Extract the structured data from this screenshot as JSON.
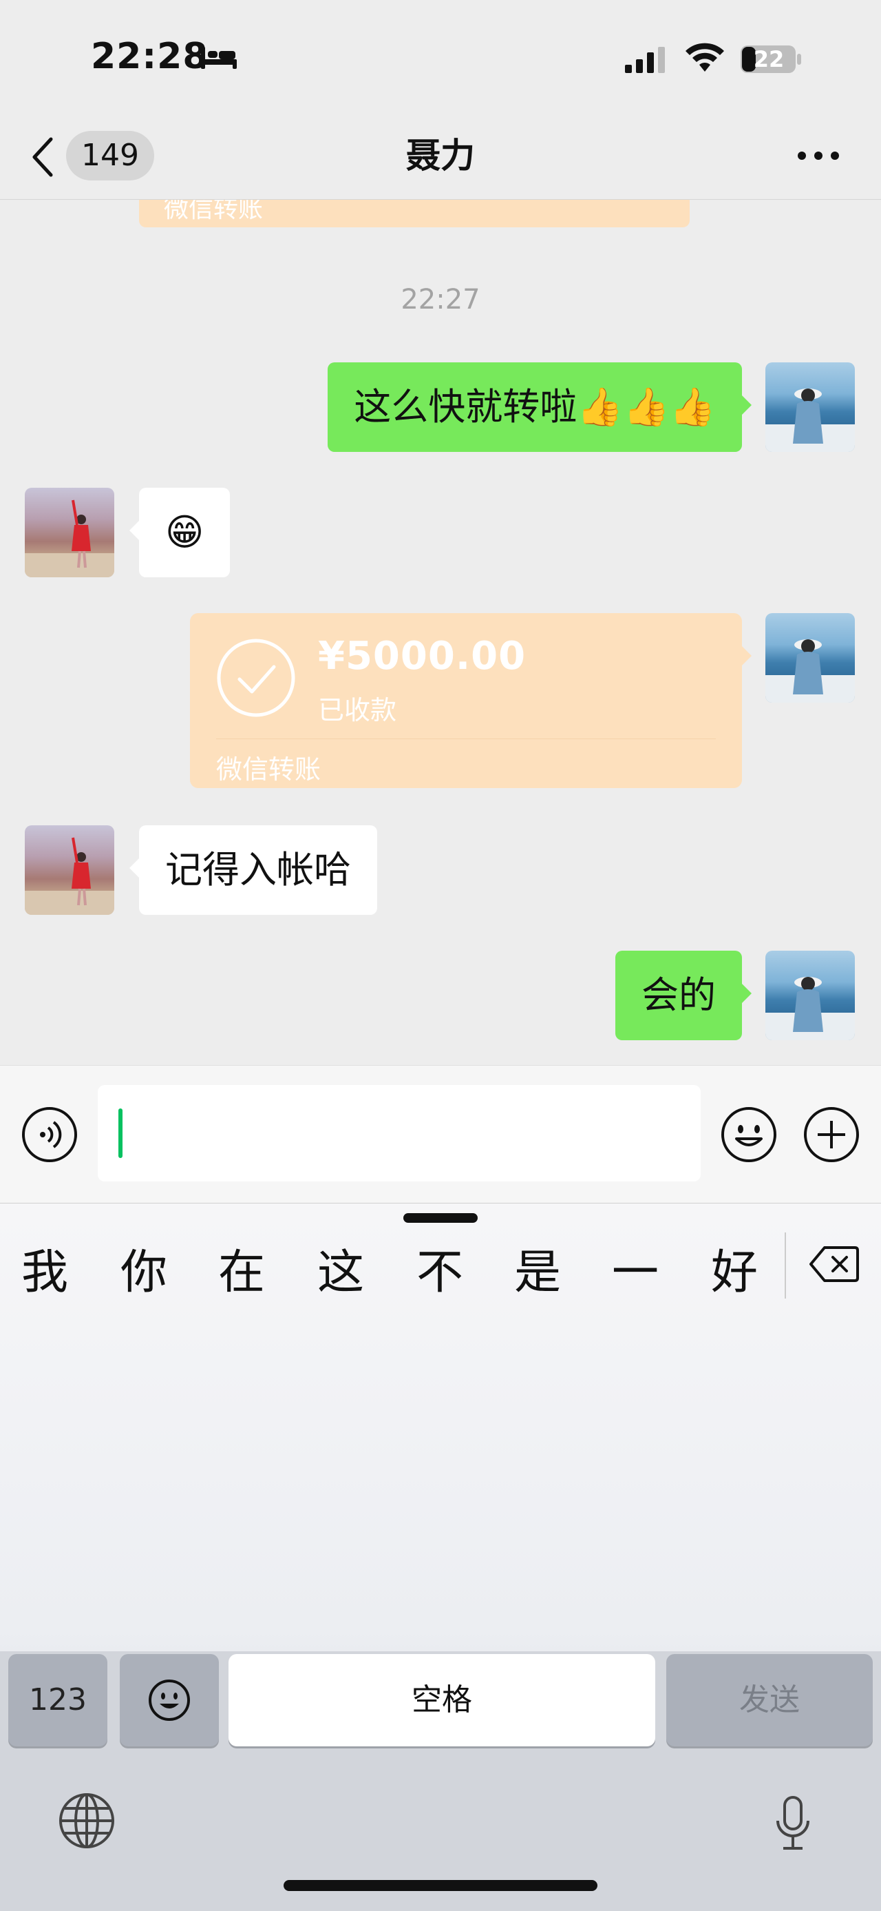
{
  "status_bar": {
    "time": "22:28",
    "battery": "22",
    "icons": [
      "bed-icon",
      "signal-icon",
      "wifi-icon",
      "battery-icon"
    ]
  },
  "nav": {
    "back_count": "149",
    "title": "聂力",
    "icons": [
      "chevron-left-icon",
      "more-icon"
    ]
  },
  "chat": {
    "partial_transfer_label": "微信转账",
    "timestamp": "22:27",
    "messages": [
      {
        "from": "me",
        "text": "这么快就转啦👍👍👍"
      },
      {
        "from": "other",
        "text": "😁"
      },
      {
        "from": "me",
        "type": "transfer",
        "amount": "¥5000.00",
        "status": "已收款",
        "label": "微信转账"
      },
      {
        "from": "other",
        "text": "记得入帐哈"
      },
      {
        "from": "me",
        "text": "会的"
      }
    ]
  },
  "input_bar": {
    "value": "",
    "icons": [
      "voice-icon",
      "emoji-icon",
      "plus-icon"
    ]
  },
  "keyboard": {
    "candidates": [
      "我",
      "你",
      "在",
      "这",
      "不",
      "是",
      "一",
      "好"
    ],
    "keys": {
      "numbers": "123",
      "space": "空格",
      "send": "发送"
    },
    "icons": [
      "delete-icon",
      "emoji-key-icon",
      "globe-icon",
      "mic-icon"
    ]
  },
  "colors": {
    "my_bubble": "#77e95b",
    "other_bubble": "#ffffff",
    "transfer_card": "#fde0bd",
    "chat_bg": "#ededed",
    "accent": "#07c160"
  }
}
